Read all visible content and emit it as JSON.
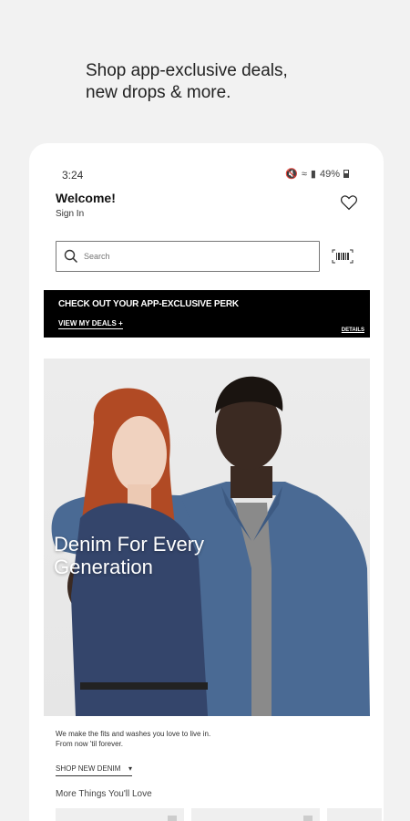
{
  "promo_headline": {
    "line1": "Shop app-exclusive deals,",
    "line2": "new drops & more."
  },
  "status_bar": {
    "time": "3:24",
    "battery": "49%"
  },
  "header": {
    "welcome": "Welcome!",
    "sign_in": "Sign In"
  },
  "search": {
    "placeholder": "Search"
  },
  "promo_banner": {
    "title": "CHECK OUT YOUR APP-EXCLUSIVE PERK",
    "link": "VIEW MY DEALS +",
    "details": "DETAILS"
  },
  "hero": {
    "title_line1": "Denim For Every",
    "title_line2": "Generation",
    "desc_line1": "We make the fits and washes you love to live in.",
    "desc_line2": "From now 'til forever.",
    "cta": "SHOP NEW DENIM",
    "cta_icon": "chevron-down"
  },
  "more_section": {
    "title": "More Things You'll Love"
  },
  "colors": {
    "background": "#f2f2f2",
    "promo_banner": "#000000",
    "denim": "#4a6a94"
  }
}
